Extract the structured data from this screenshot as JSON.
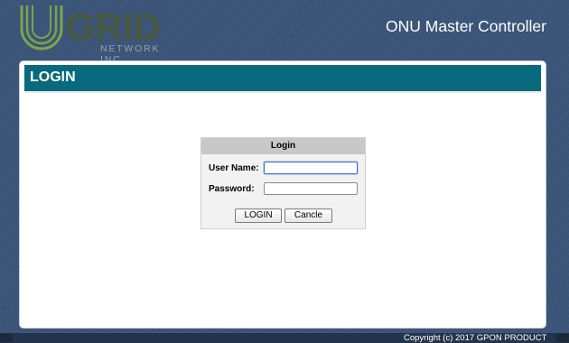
{
  "header": {
    "logo": {
      "wordmark": "GRID",
      "subtitle": "NETWORK INC."
    },
    "title": "ONU Master Controller"
  },
  "section": {
    "title": "LOGIN"
  },
  "login_form": {
    "heading": "Login",
    "username_label": "User Name:",
    "username_value": "",
    "password_label": "Password:",
    "password_value": "",
    "login_button": "LOGIN",
    "cancel_button": "Cancle"
  },
  "footer": {
    "copyright": "Copyright (c) 2017 GPON PRODUCT"
  },
  "colors": {
    "page_background": "#3a5478",
    "section_bar": "#086a7c",
    "logo_ring": "#7fa34a",
    "logo_wordmark": "#4a5a3a",
    "login_header": "#c8c8c8",
    "footer_background": "#24344c"
  }
}
